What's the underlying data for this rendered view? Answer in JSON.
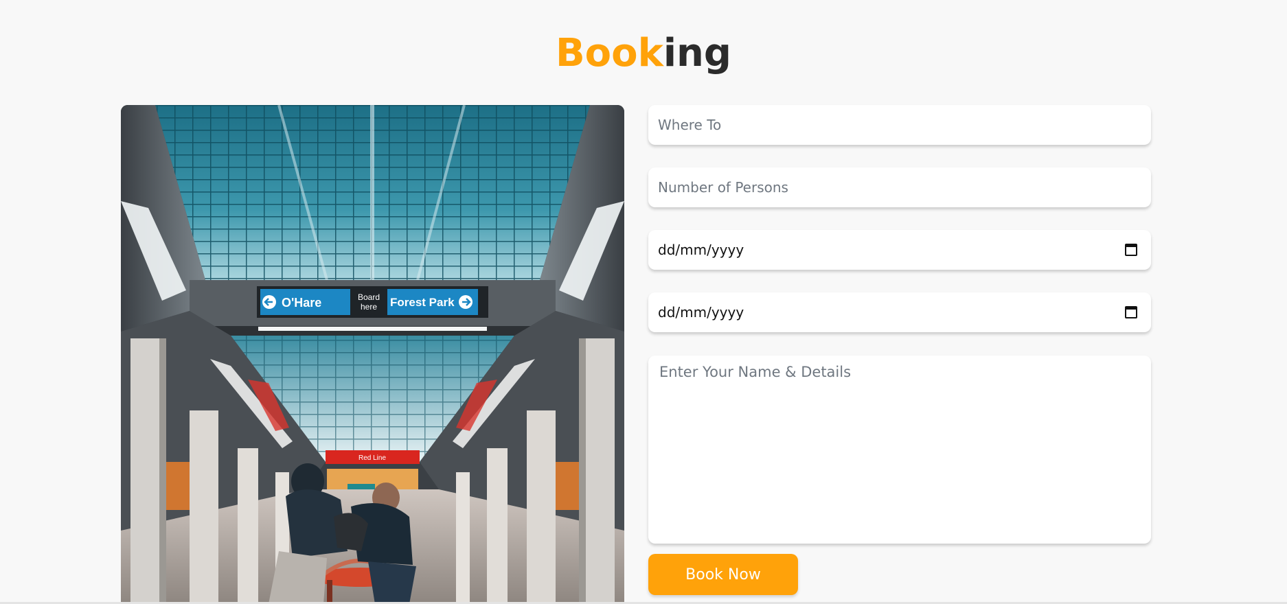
{
  "heading": {
    "accent_text": "Book",
    "rest_text": "ing"
  },
  "photo": {
    "sign_left": "O'Hare",
    "sign_center_line1": "Board",
    "sign_center_line2": "here",
    "sign_right": "Forest Park",
    "lower_sign": "Red Line"
  },
  "form": {
    "where_placeholder": "Where To",
    "persons_placeholder": "Number of Persons",
    "arrival_value": "dd/mm/yyyy",
    "leaving_value": "dd/mm/yyyy",
    "details_placeholder": "Enter Your Name & Details",
    "submit_label": "Book Now"
  },
  "colors": {
    "accent": "#ffa20a",
    "heading_dark": "#2b2b2b",
    "background": "#f8f8f8"
  },
  "icons": {
    "date_picker": "calendar-icon"
  }
}
